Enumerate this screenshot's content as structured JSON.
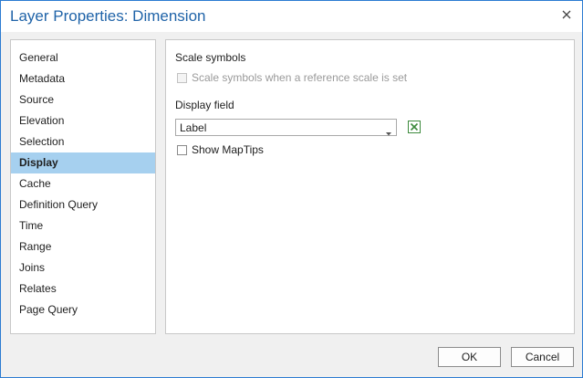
{
  "window": {
    "title": "Layer Properties: Dimension"
  },
  "icons": {
    "close": "close-icon",
    "dropdown": "chevron-down-icon",
    "expression": "expression-icon"
  },
  "colors": {
    "title": "#1f63a8",
    "selected_item_bg": "#a6d0ef",
    "window_border": "#2b7bd1",
    "expression_icon": "#3d8a3d"
  },
  "sidebar": {
    "items": [
      {
        "label": "General"
      },
      {
        "label": "Metadata"
      },
      {
        "label": "Source"
      },
      {
        "label": "Elevation"
      },
      {
        "label": "Selection"
      },
      {
        "label": "Display"
      },
      {
        "label": "Cache"
      },
      {
        "label": "Definition Query"
      },
      {
        "label": "Time"
      },
      {
        "label": "Range"
      },
      {
        "label": "Joins"
      },
      {
        "label": "Relates"
      },
      {
        "label": "Page Query"
      }
    ],
    "selected": "Display"
  },
  "display": {
    "scale_symbols_heading": "Scale symbols",
    "scale_symbols_checkbox_label": "Scale symbols when a reference scale is set",
    "scale_symbols_checked": false,
    "scale_symbols_enabled": false,
    "display_field_heading": "Display field",
    "display_field_value": "Label",
    "show_maptips_label": "Show MapTips",
    "show_maptips_checked": false
  },
  "footer": {
    "ok_label": "OK",
    "cancel_label": "Cancel"
  }
}
